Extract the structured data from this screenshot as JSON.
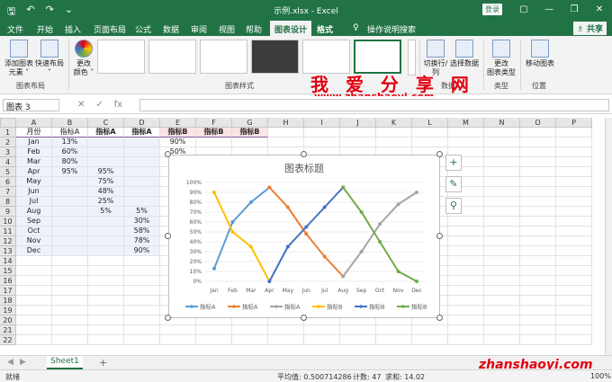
{
  "window": {
    "title": "示例.xlsx  -  Excel",
    "login": "登录",
    "tb_icons": [
      "save-icon",
      "undo-icon",
      "redo-icon",
      "customize-icon"
    ],
    "controls": [
      "—",
      "❐",
      "✕"
    ]
  },
  "tabs": [
    "文件",
    "开始",
    "插入",
    "页面布局",
    "公式",
    "数据",
    "审阅",
    "视图",
    "帮助",
    "图表设计",
    "格式",
    "♀",
    "操作说明搜索"
  ],
  "active_tab": "图表设计",
  "share": "♗ 共享",
  "ribbon": {
    "add_element": "添加图表\n元素 ˅",
    "quick_layout": "快速布局\n˅",
    "change_colors": "更改\n颜色 ˅",
    "switch_rowcol": "切换行/列",
    "select_data": "选择数据",
    "change_type": "更改\n图表类型",
    "move_chart": "移动图表",
    "groups": [
      "图表布局",
      "图表样式",
      "数据",
      "类型",
      "位置"
    ]
  },
  "watermark": {
    "text": "我 爱 分 享 网",
    "url": "www.zhanshaoyi.com",
    "bottom": "zhanshaoyi.com"
  },
  "formula": {
    "namebox": "图表 3",
    "fx": [
      "✕",
      "✓",
      "fx"
    ]
  },
  "columns": [
    "A",
    "B",
    "C",
    "D",
    "E",
    "F",
    "G",
    "H",
    "I",
    "J",
    "K",
    "L",
    "M",
    "N",
    "O",
    "P"
  ],
  "rows": [
    "1",
    "2",
    "3",
    "4",
    "5",
    "6",
    "7",
    "8",
    "9",
    "10",
    "11",
    "12",
    "13",
    "14",
    "15",
    "16",
    "17",
    "18",
    "19",
    "20",
    "21",
    "22"
  ],
  "headers": [
    "月份",
    "指标A",
    "指标A",
    "指标A",
    "指标B",
    "指标B",
    "指标B"
  ],
  "months": [
    "Jan",
    "Feb",
    "Mar",
    "Apr",
    "May",
    "Jun",
    "Jul",
    "Aug",
    "Sep",
    "Oct",
    "Nov",
    "Dec"
  ],
  "colB": [
    "13%",
    "60%",
    "80%",
    "95%",
    "",
    "",
    "",
    "",
    "",
    "",
    "",
    ""
  ],
  "colC": [
    "",
    "",
    "",
    "95%",
    "75%",
    "48%",
    "25%",
    "5%",
    "",
    "",
    "",
    ""
  ],
  "colD": [
    "",
    "",
    "",
    "",
    "",
    "",
    "",
    "5%",
    "30%",
    "58%",
    "78%",
    "90%"
  ],
  "colE": [
    "90%",
    "50%",
    "",
    "",
    "",
    "",
    "",
    "",
    "",
    "",
    "",
    ""
  ],
  "chart_data": {
    "type": "line",
    "title": "图表标题",
    "categories": [
      "Jan",
      "Feb",
      "Mar",
      "Apr",
      "May",
      "Jun",
      "Jul",
      "Aug",
      "Sep",
      "Oct",
      "Nov",
      "Dec"
    ],
    "ylim": [
      0,
      100
    ],
    "yticks": [
      "0%",
      "10%",
      "20%",
      "30%",
      "40%",
      "50%",
      "60%",
      "70%",
      "80%",
      "90%",
      "100%"
    ],
    "grid": true,
    "legend": "bottom",
    "series": [
      {
        "name": "指标A",
        "color": "#5b9bd5",
        "values": [
          13,
          60,
          80,
          95,
          null,
          null,
          null,
          null,
          null,
          null,
          null,
          null
        ]
      },
      {
        "name": "指标A",
        "color": "#ed7d31",
        "values": [
          null,
          null,
          null,
          95,
          75,
          48,
          25,
          5,
          null,
          null,
          null,
          null
        ]
      },
      {
        "name": "指标A",
        "color": "#a5a5a5",
        "values": [
          null,
          null,
          null,
          null,
          null,
          null,
          null,
          5,
          30,
          58,
          78,
          90
        ]
      },
      {
        "name": "指标B",
        "color": "#ffc000",
        "values": [
          90,
          50,
          35,
          0,
          null,
          null,
          null,
          null,
          null,
          null,
          null,
          null
        ]
      },
      {
        "name": "指标B",
        "color": "#4472c4",
        "values": [
          null,
          null,
          null,
          0,
          35,
          55,
          75,
          95,
          null,
          null,
          null,
          null
        ]
      },
      {
        "name": "指标B",
        "color": "#70ad47",
        "values": [
          null,
          null,
          null,
          null,
          null,
          null,
          null,
          95,
          70,
          40,
          10,
          0
        ]
      }
    ]
  },
  "sheet": {
    "tab": "Sheet1",
    "add": "+"
  },
  "status": {
    "ready": "就绪",
    "avg": "平均值: 0.500714286",
    "count": "计数: 47",
    "sum": "求和: 14.02",
    "zoom": "100%"
  }
}
